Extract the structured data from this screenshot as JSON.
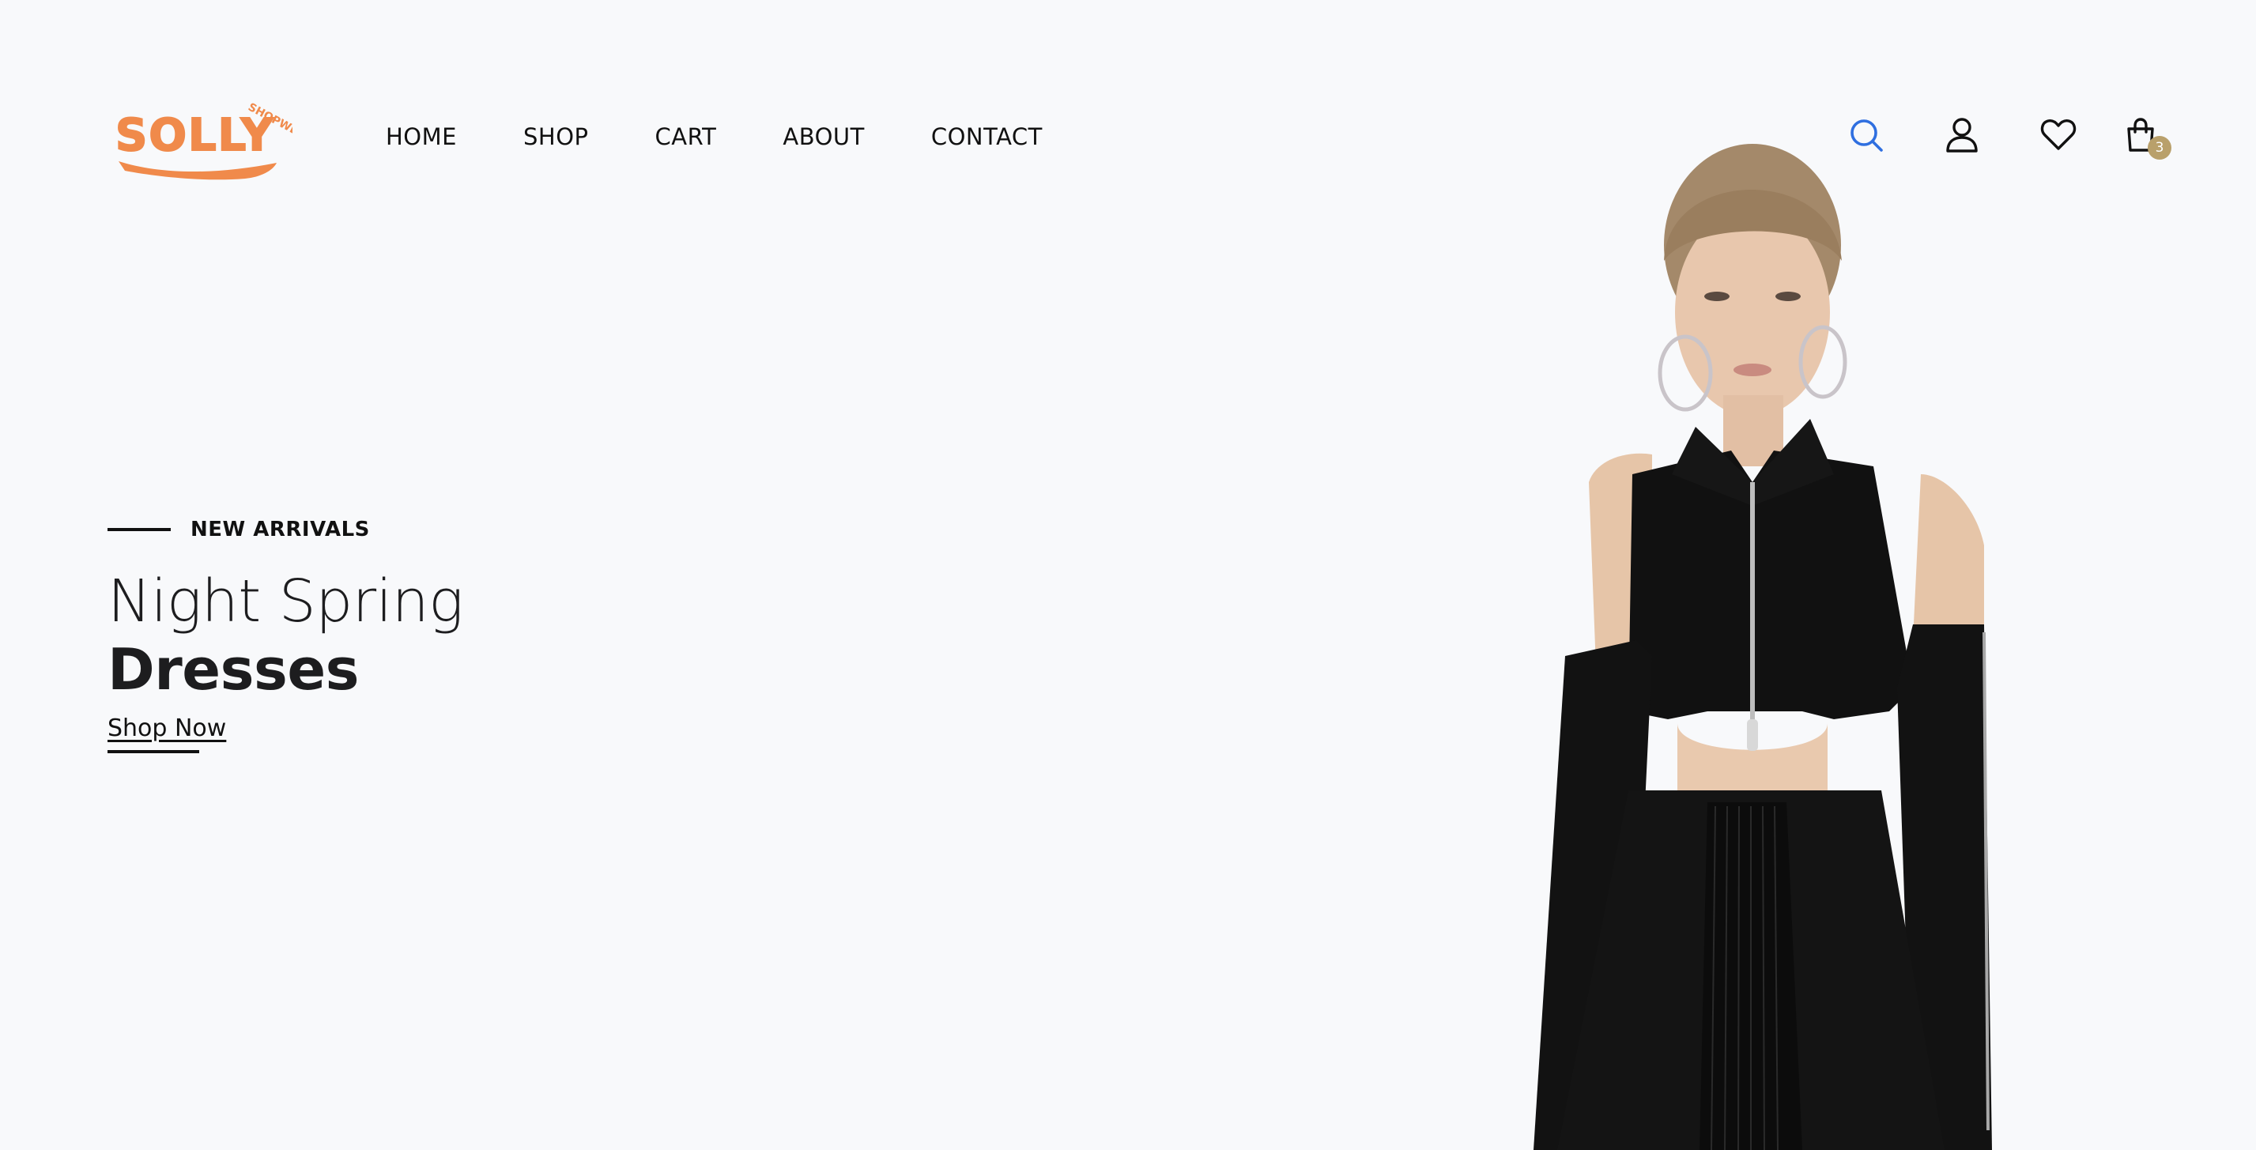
{
  "brand": {
    "name": "SOLLY",
    "tagline": "SHOPWE",
    "color": "#f08a4b"
  },
  "nav": {
    "items": [
      {
        "label": "HOME"
      },
      {
        "label": "SHOP"
      },
      {
        "label": "CART"
      },
      {
        "label": "ABOUT"
      },
      {
        "label": "CONTACT"
      }
    ]
  },
  "header_icons": {
    "search": "search-icon",
    "account": "user-icon",
    "wishlist": "heart-icon",
    "cart": "shopping-bag-icon",
    "cart_count": "3",
    "search_color": "#2f6fe0",
    "badge_color": "#b9a06b"
  },
  "hero": {
    "eyebrow": "NEW ARRIVALS",
    "title_line1": "Night Spring",
    "title_line2": "Dresses",
    "cta": "Shop Now"
  },
  "colors": {
    "background": "#f8f9fb",
    "text": "#1d1d1f"
  }
}
